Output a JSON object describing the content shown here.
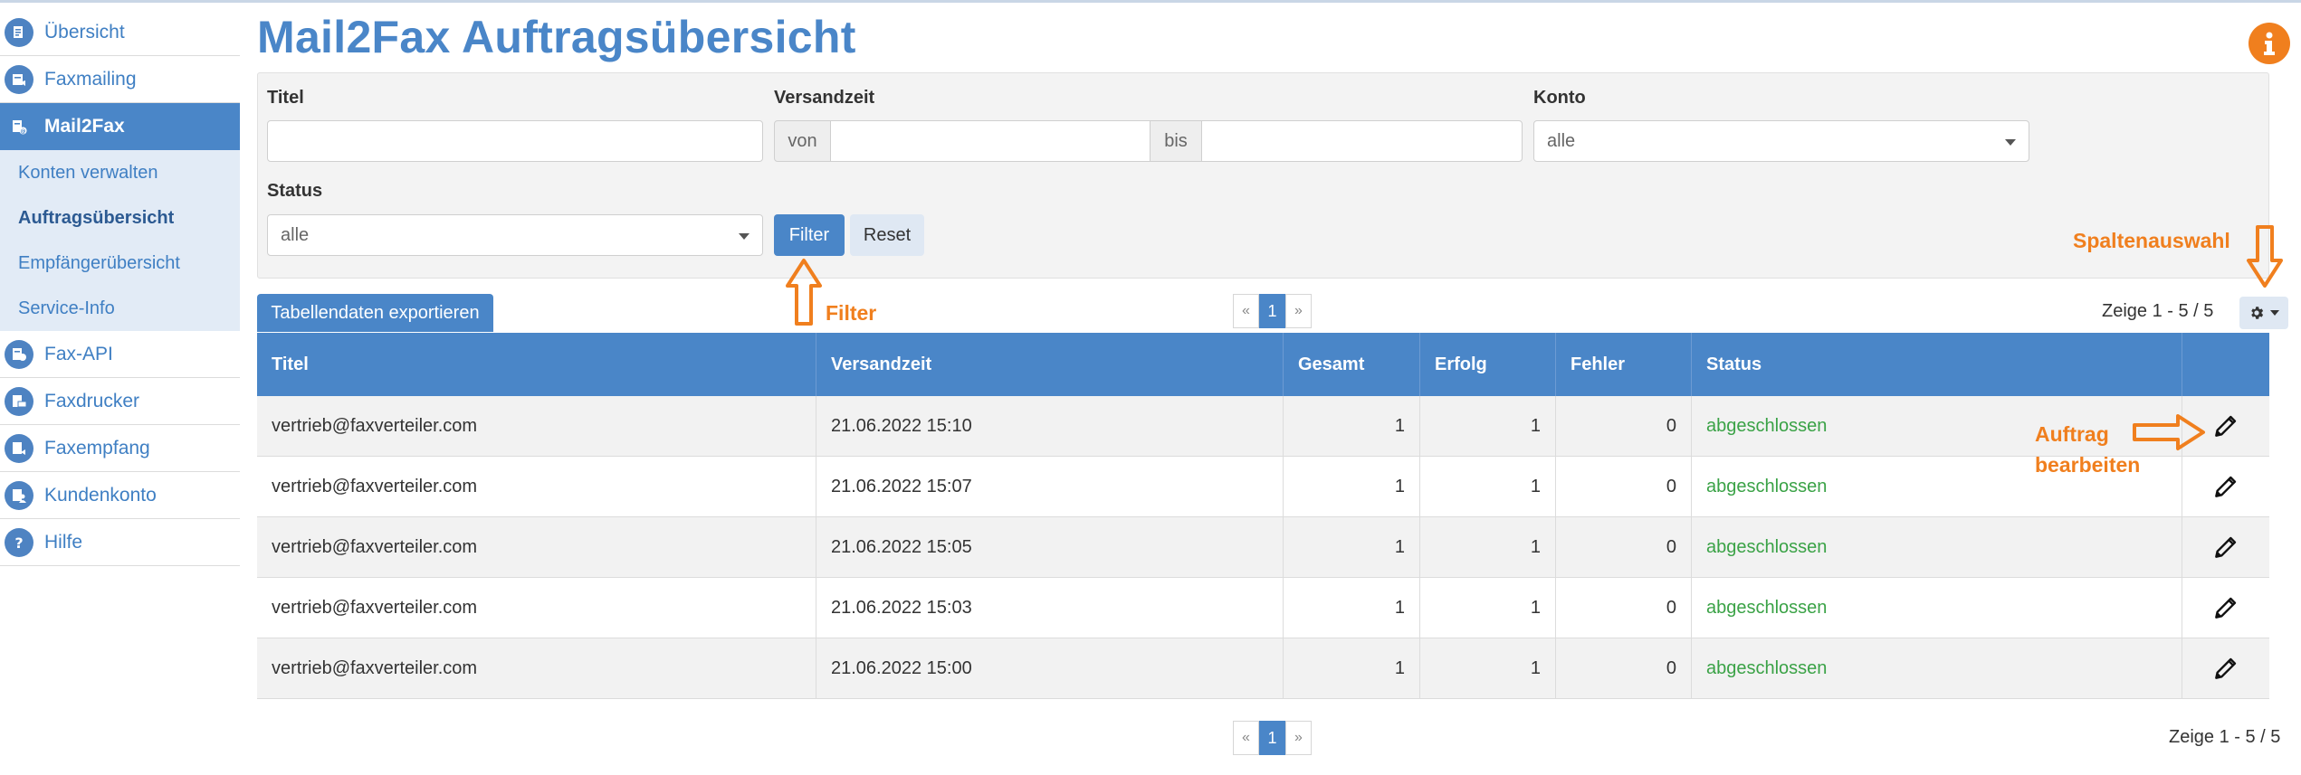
{
  "sidebar": {
    "items": [
      {
        "label": "Übersicht",
        "icon": "overview-icon"
      },
      {
        "label": "Faxmailing",
        "icon": "faxmailing-icon"
      },
      {
        "label": "Mail2Fax",
        "icon": "mail2fax-icon"
      },
      {
        "label": "Fax-API",
        "icon": "fax-api-icon"
      },
      {
        "label": "Faxdrucker",
        "icon": "fax-printer-icon"
      },
      {
        "label": "Faxempfang",
        "icon": "fax-receive-icon"
      },
      {
        "label": "Kundenkonto",
        "icon": "customer-account-icon"
      },
      {
        "label": "Hilfe",
        "icon": "help-icon"
      }
    ],
    "submenu": [
      "Konten verwalten",
      "Auftragsübersicht",
      "Empfängerübersicht",
      "Service-Info"
    ]
  },
  "page": {
    "title": "Mail2Fax Auftragsübersicht"
  },
  "filter": {
    "titel_label": "Titel",
    "versandzeit_label": "Versandzeit",
    "von": "von",
    "bis": "bis",
    "konto_label": "Konto",
    "konto_value": "alle",
    "status_label": "Status",
    "status_value": "alle",
    "filter_button": "Filter",
    "reset_button": "Reset"
  },
  "toolbar": {
    "export_button": "Tabellendaten exportieren",
    "pager": {
      "prev": "«",
      "current": "1",
      "next": "»"
    },
    "showing": "Zeige 1 - 5 / 5"
  },
  "table": {
    "headers": [
      "Titel",
      "Versandzeit",
      "Gesamt",
      "Erfolg",
      "Fehler",
      "Status"
    ],
    "rows": [
      [
        "vertrieb@faxverteiler.com",
        "21.06.2022 15:10",
        "1",
        "1",
        "0",
        "abgeschlossen"
      ],
      [
        "vertrieb@faxverteiler.com",
        "21.06.2022 15:07",
        "1",
        "1",
        "0",
        "abgeschlossen"
      ],
      [
        "vertrieb@faxverteiler.com",
        "21.06.2022 15:05",
        "1",
        "1",
        "0",
        "abgeschlossen"
      ],
      [
        "vertrieb@faxverteiler.com",
        "21.06.2022 15:03",
        "1",
        "1",
        "0",
        "abgeschlossen"
      ],
      [
        "vertrieb@faxverteiler.com",
        "21.06.2022 15:00",
        "1",
        "1",
        "0",
        "abgeschlossen"
      ]
    ]
  },
  "footer": {
    "pager": {
      "prev": "«",
      "current": "1",
      "next": "»"
    },
    "showing": "Zeige 1 - 5 / 5"
  },
  "annotations": {
    "spaltenauswahl": "Spaltenauswahl",
    "filter": "Filter",
    "auftrag_1": "Auftrag",
    "auftrag_2": "bearbeiten"
  },
  "colors": {
    "primary": "#4a86c8",
    "accent": "#f07f1e",
    "success": "#3aa246"
  }
}
